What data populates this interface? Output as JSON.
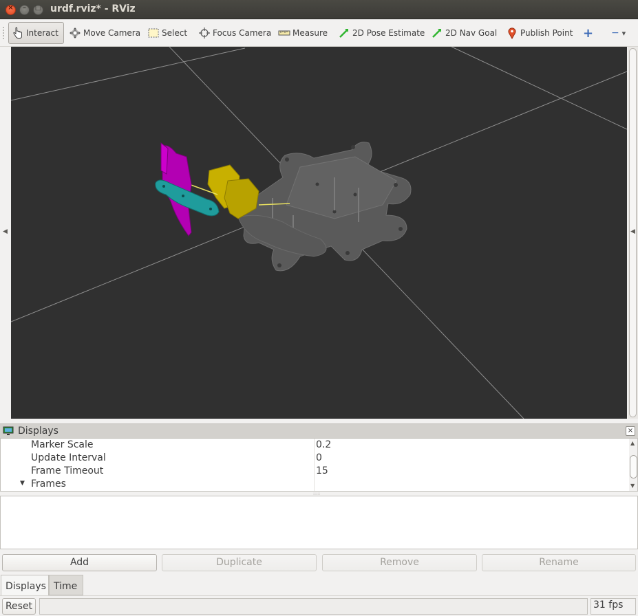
{
  "window": {
    "title": "urdf.rviz* - RViz",
    "close_glyph": "×",
    "min_glyph": "–",
    "max_glyph": "□"
  },
  "toolbar": {
    "tools": [
      {
        "label": "Interact",
        "icon": "hand-pointer-icon",
        "active": true
      },
      {
        "label": "Move Camera",
        "icon": "move-camera-icon",
        "active": false
      },
      {
        "label": "Select",
        "icon": "select-box-icon",
        "active": false
      },
      {
        "label": "Focus Camera",
        "icon": "crosshair-icon",
        "active": false
      },
      {
        "label": "Measure",
        "icon": "ruler-icon",
        "active": false
      },
      {
        "label": "2D Pose Estimate",
        "icon": "green-arrow-icon",
        "active": false
      },
      {
        "label": "2D Nav Goal",
        "icon": "green-arrow-icon",
        "active": false
      },
      {
        "label": "Publish Point",
        "icon": "map-pin-icon",
        "active": false
      }
    ],
    "add_tool_glyph": "+",
    "remove_tool_glyph": "−",
    "menu_glyph": "▾"
  },
  "viewport": {
    "background": "#303030",
    "grid_color": "#a0a0a0",
    "frame_color": "#5a5a5a",
    "left_handle_glyph": "◀",
    "right_handle_glyph": "◀"
  },
  "displays": {
    "title": "Displays",
    "close_glyph": "×",
    "properties": [
      {
        "name": "Marker Scale",
        "value": "0.2"
      },
      {
        "name": "Update Interval",
        "value": "0"
      },
      {
        "name": "Frame Timeout",
        "value": "15"
      },
      {
        "name": "Frames",
        "value": "",
        "expander": "▼"
      }
    ],
    "scroll_up": "▲",
    "scroll_down": "▼",
    "splitter_glyph": ":::::",
    "buttons": {
      "add": "Add",
      "duplicate": "Duplicate",
      "remove": "Remove",
      "rename": "Rename"
    }
  },
  "tabs": {
    "displays": "Displays",
    "time": "Time"
  },
  "status": {
    "reset": "Reset",
    "message": "",
    "fps": "31 fps"
  }
}
